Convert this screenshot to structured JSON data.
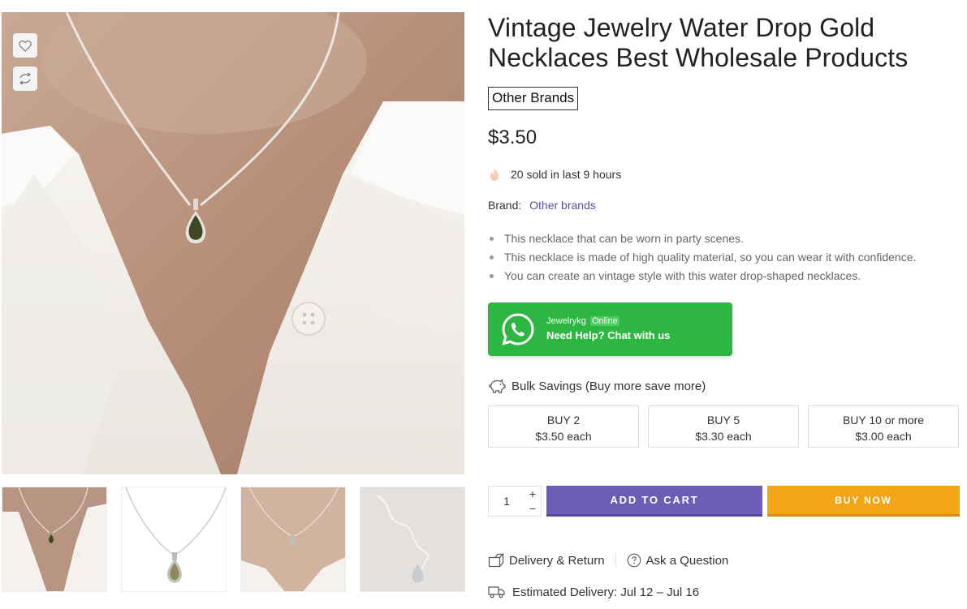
{
  "gallery": {
    "main_image_alt": "Woman wearing silver chain necklace with green teardrop pendant",
    "wishlist_icon": "heart-icon",
    "compare_icon": "compare-arrows-icon",
    "thumbnails": [
      "model-closeup",
      "product-flat",
      "model-wide",
      "chain-detail"
    ]
  },
  "product": {
    "title": "Vintage Jewelry Water Drop Gold Necklaces Best Wholesale Products",
    "brand_badge": "Other Brands",
    "price": "$3.50",
    "sold_text": "20 sold in last 9 hours",
    "brand_label": "Brand:",
    "brand_link": "Other brands",
    "features": [
      "This necklace that can be worn in party scenes.",
      "This necklace is made of high quality material, so you can wear it with confidence.",
      "You can create an vintage style with this water drop-shaped necklaces."
    ]
  },
  "whatsapp": {
    "name": "Jewelrykg",
    "status": "Online",
    "help_text": "Need Help? Chat with us",
    "color": "#2db742"
  },
  "bulk": {
    "title": "Bulk Savings (Buy more save more)",
    "tiers": [
      {
        "label": "BUY 2",
        "price": "$3.50 each"
      },
      {
        "label": "BUY 5",
        "price": "$3.30 each"
      },
      {
        "label": "BUY 10 or more",
        "price": "$3.00 each"
      }
    ]
  },
  "cart": {
    "quantity": "1",
    "plus": "+",
    "minus": "−",
    "add_to_cart": "ADD TO CART",
    "buy_now": "BUY NOW",
    "cart_color": "#6b5db3",
    "buy_color": "#f2a516"
  },
  "extras": {
    "delivery_return": "Delivery & Return",
    "ask_question": "Ask a Question",
    "estimated_delivery": "Estimated Delivery: Jul 12 – Jul 16"
  }
}
